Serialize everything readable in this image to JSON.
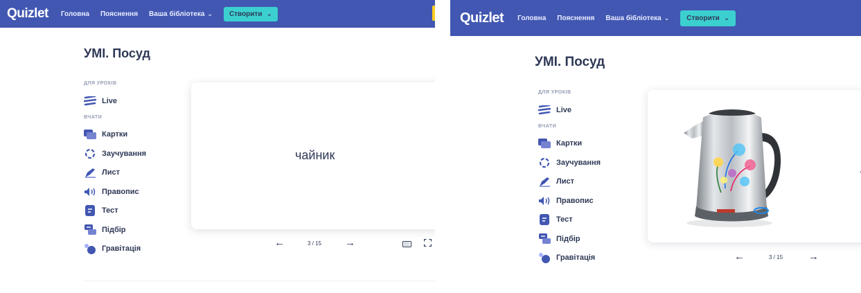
{
  "nav": {
    "logo": "Quizlet",
    "home": "Головна",
    "explanations": "Пояснення",
    "library": "Ваша бібліотека",
    "create": "Створити"
  },
  "set_title": "УМІ. Посуд",
  "sidebar": {
    "section_lessons": "ДЛЯ УРОКІВ",
    "live": "Live",
    "section_study": "ВЧАТИ",
    "items": [
      {
        "label": "Картки",
        "icon": "cards-icon"
      },
      {
        "label": "Заучування",
        "icon": "learn-icon"
      },
      {
        "label": "Лист",
        "icon": "write-icon"
      },
      {
        "label": "Правопис",
        "icon": "spell-icon"
      },
      {
        "label": "Тест",
        "icon": "test-icon"
      },
      {
        "label": "Підбір",
        "icon": "match-icon"
      },
      {
        "label": "Гравітація",
        "icon": "gravity-icon"
      }
    ]
  },
  "flashcard": {
    "front_term": "чайник",
    "back_image": "electric-kettle-image",
    "more_label": "...",
    "counter": "3 / 15"
  },
  "colors": {
    "nav_bg": "#4257b2",
    "create_btn": "#3ccfcf",
    "text": "#2e3856"
  }
}
